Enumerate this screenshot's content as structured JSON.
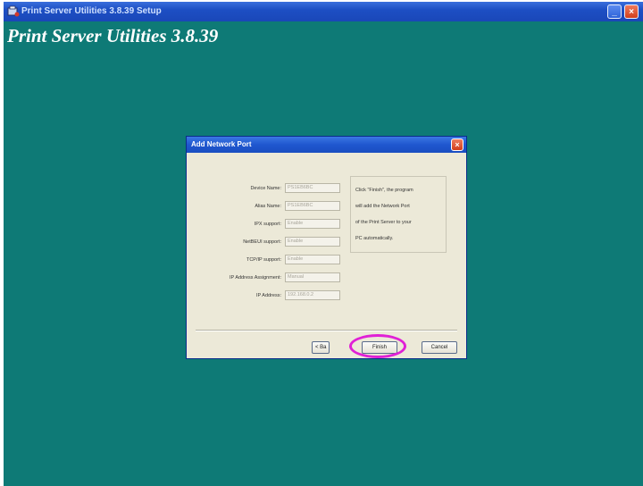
{
  "window": {
    "title": "Print Server Utilities 3.8.39 Setup",
    "heading": "Print Server Utilities 3.8.39",
    "minimize_glyph": "_",
    "close_glyph": "×"
  },
  "dialog": {
    "title": "Add Network Port",
    "close_glyph": "×",
    "fields": [
      {
        "label": "Device Name:",
        "value": "PS1EB6BC"
      },
      {
        "label": "Alias Name:",
        "value": "PS1EB6BC"
      },
      {
        "label": "IPX support:",
        "value": "Enable"
      },
      {
        "label": "NetBEUI support:",
        "value": "Enable"
      },
      {
        "label": "TCP/IP support:",
        "value": "Enable"
      },
      {
        "label": "IP Address Assignment:",
        "value": "Manual"
      },
      {
        "label": "IP Address:",
        "value": "192.168.0.2"
      }
    ],
    "message_lines": [
      "Click \"Finish\", the program",
      "will add the Network Port",
      "of the Print Server to your",
      "PC automatically."
    ],
    "buttons": {
      "back": "< Ba",
      "finish": "Finish",
      "cancel": "Cancel"
    }
  },
  "colors": {
    "desktop_bg": "#0e7a76",
    "highlight": "#e020d6"
  }
}
